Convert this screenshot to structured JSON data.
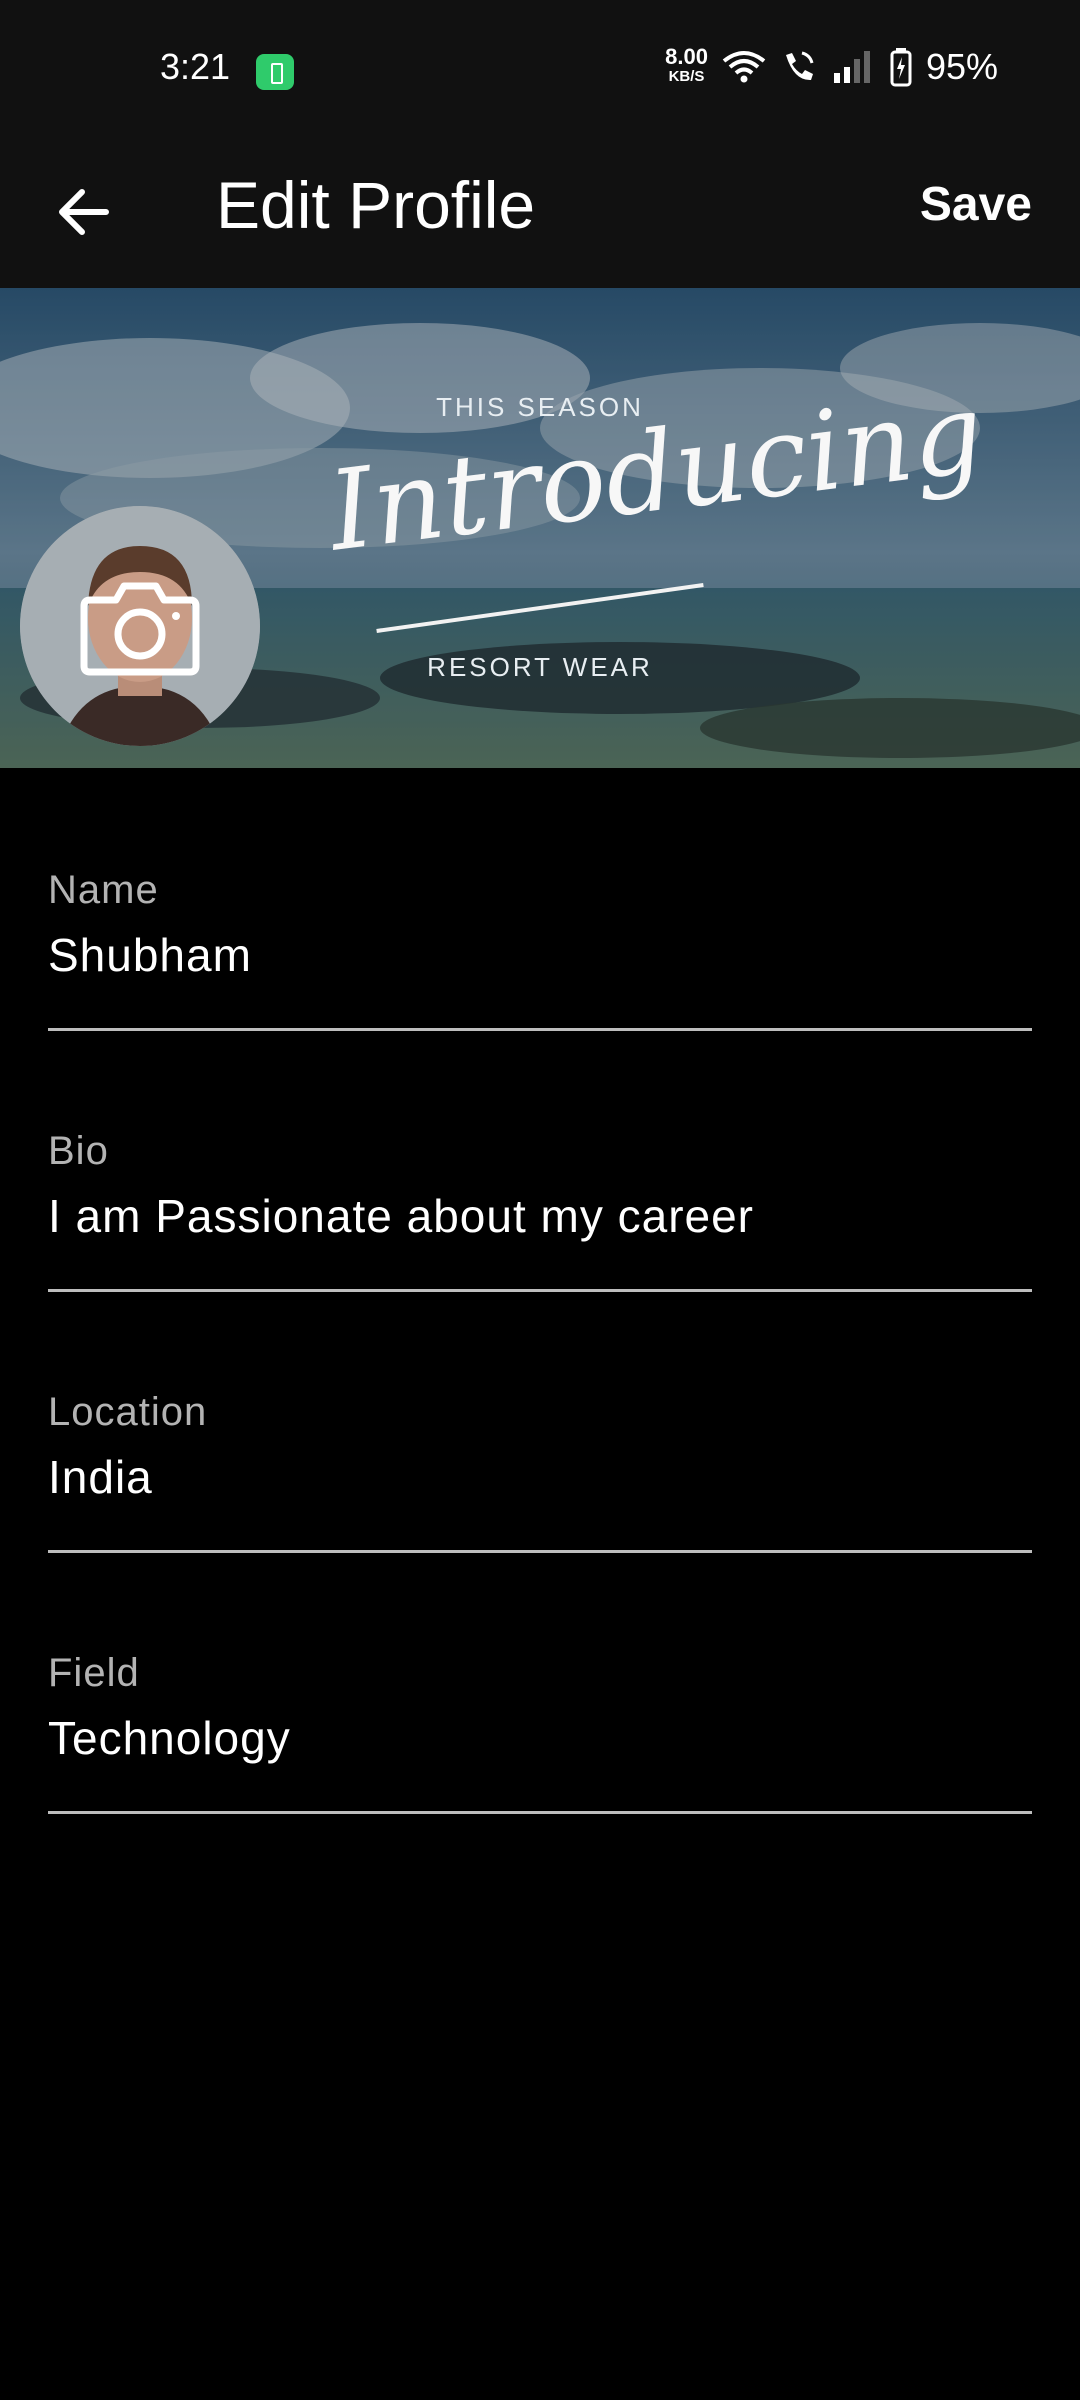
{
  "status_bar": {
    "time": "3:21",
    "net_speed_value": "8.00",
    "net_speed_unit": "KB/S",
    "battery_percent": "95%",
    "charging_color": "#2fcb6b"
  },
  "app_bar": {
    "title": "Edit Profile",
    "save_label": "Save",
    "back_icon": "arrow-left-icon"
  },
  "banner": {
    "kicker": "THIS SEASON",
    "headline": "Introducing",
    "tagline": "RESORT WEAR"
  },
  "avatar": {
    "overlay_icon": "camera-icon"
  },
  "fields": [
    {
      "label": "Name",
      "value": "Shubham"
    },
    {
      "label": "Bio",
      "value": "I am Passionate about my career"
    },
    {
      "label": "Location",
      "value": "India"
    },
    {
      "label": "Field",
      "value": "Technology"
    }
  ]
}
